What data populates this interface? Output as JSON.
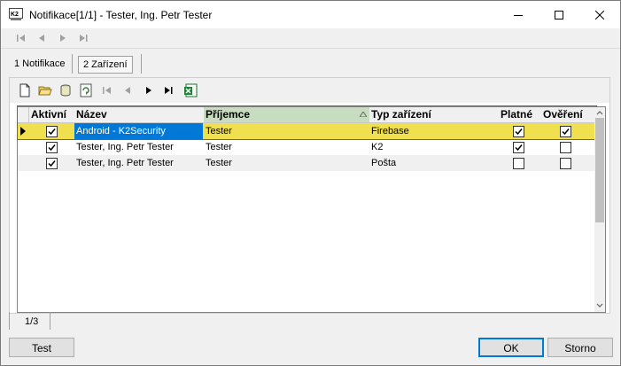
{
  "window": {
    "title": "Notifikace[1/1] - Tester, Ing. Petr Tester",
    "icon_text": "K2"
  },
  "tabs": [
    {
      "label": "1 Notifikace",
      "active": false
    },
    {
      "label": "2 Zařízení",
      "active": true
    }
  ],
  "grid": {
    "columns": [
      "Aktivní",
      "Název",
      "Příjemce",
      "Typ zařízení",
      "Platné",
      "Ověření"
    ],
    "sorted_column": "Příjemce",
    "rows": [
      {
        "active": true,
        "name": "Android - K2Security",
        "recipient": "Tester",
        "device_type": "Firebase",
        "valid": true,
        "verified": true,
        "selected": true
      },
      {
        "active": true,
        "name": "Tester, Ing. Petr Tester",
        "recipient": "Tester",
        "device_type": "K2",
        "valid": true,
        "verified": false,
        "selected": false
      },
      {
        "active": true,
        "name": "Tester, Ing. Petr Tester",
        "recipient": "Tester",
        "device_type": "Pošta",
        "valid": false,
        "verified": false,
        "selected": false
      }
    ]
  },
  "status": {
    "record_position": "1/3"
  },
  "buttons": {
    "test": "Test",
    "ok": "OK",
    "cancel": "Storno"
  },
  "colors": {
    "selected_row": "#f0e050",
    "selected_cell": "#0078d7",
    "sorted_header": "#c8dcc0",
    "highlight_frame": "#e0303a"
  }
}
